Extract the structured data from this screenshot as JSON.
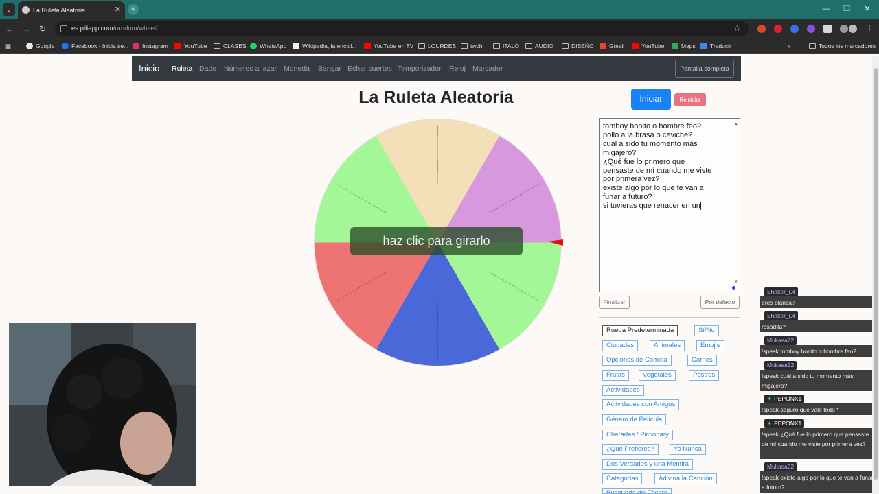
{
  "browser": {
    "tab_title": "La Ruleta Aleatoria",
    "url_host": "es.piliapp.com",
    "url_path": "/random/wheel/",
    "bookmarks": [
      "Google",
      "Facebook - Inicia se...",
      "Instagram",
      "YouTube",
      "CLASES",
      "WhatsApp",
      "Wikipedia, la encicl...",
      "YouTube en TV",
      "LOURDES",
      "twch",
      "ITALO",
      "AUDIO",
      "DISEÑO",
      "Gmail",
      "YouTube",
      "Maps",
      "Traducir"
    ],
    "bookmarks_more": "»",
    "all_bookmarks": "Todos los marcadores"
  },
  "nav": {
    "brand": "Inicio",
    "links": [
      "Ruleta",
      "Dado",
      "Números al azar",
      "Moneda",
      "Barajar",
      "Echar suertes",
      "Temporizador",
      "Reloj",
      "Marcador"
    ],
    "fullscreen": "Pantalla completa"
  },
  "main": {
    "title": "La Ruleta Aleatoria",
    "spin_hint": "haz clic para girarlo",
    "start_label": "Iniciar",
    "reset_label": "Reiniciar",
    "options_lines": [
      "tomboy bonito o hombre feo?",
      "pollo a la brasa o ceviche?",
      "cuál a sido tu momento más",
      "migajero?",
      "¿Qué fue lo primero que",
      "pensaste de mí cuando me viste",
      "por primera vez?",
      "existe algo por lo que te van a",
      "funar a futuro?",
      "si tuvieras que renacer en un"
    ],
    "finish_label": "Finalizar",
    "default_label": "Por defecto",
    "presets": [
      "Rueda Predeterminada",
      "Sí/No",
      "Ciudades",
      "Animales",
      "Emojis",
      "Opciones de Comida",
      "Carnes",
      "Frutas",
      "Vegetales",
      "Postres",
      "Actividades",
      "Actividades con Amigos",
      "Género de Película",
      "Charadas / Pictionary",
      "¿Qué Prefieres?",
      "Yo Nunca",
      "Dos Verdades y una Mentira",
      "Categorías",
      "Adivina la Canción",
      "Búsqueda del Tesoro"
    ]
  },
  "wheel": {
    "colors": [
      "#f3dfb8",
      "#d898de",
      "#a3f797",
      "#4b68d8",
      "#ee7474",
      "#a3f797"
    ],
    "pointer_color": "#dd1111"
  },
  "chat": [
    {
      "user": "Shaker_L4",
      "text": "eres blanca?",
      "badge": false
    },
    {
      "user": "Shaker_L4",
      "text": "rosadita?",
      "badge": false
    },
    {
      "user": "Mukasa22",
      "text": "!speak tomboy bonito o hombre feo?",
      "badge": false
    },
    {
      "user": "Mukasa22",
      "text": "!speak cuál a sido tu momento más migajero?",
      "badge": false
    },
    {
      "user": "PEPONX1",
      "text": "!speak seguro que vale todo *",
      "badge": true
    },
    {
      "user": "PEPONX1",
      "text": "!speak ¿Qué fue lo primero que pensaste de mí cuando me viste por primera vez?",
      "badge": true
    },
    {
      "user": "Mukasa22",
      "text": "!speak existe algo por lo que te van a funar a futuro?",
      "badge": false
    }
  ]
}
